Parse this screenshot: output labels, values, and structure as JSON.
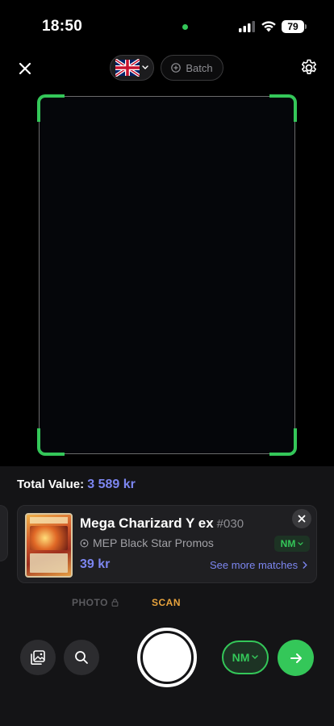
{
  "status_bar": {
    "time": "18:50",
    "battery": "79",
    "icons": [
      "signal-icon",
      "wifi-icon",
      "battery-icon"
    ]
  },
  "top_bar": {
    "close_icon": "close-icon",
    "language_flag": "uk-flag-icon",
    "batch_label": "Batch",
    "settings_icon": "gear-icon"
  },
  "summary": {
    "total_label": "Total Value:",
    "total_value": "3 589 kr"
  },
  "result_card": {
    "name": "Mega Charizard Y ex",
    "number": "#030",
    "set": "MEP Black Star Promos",
    "price": "39 kr",
    "condition": "NM",
    "see_more_label": "See more matches"
  },
  "mode_tabs": {
    "photo": "PHOTO",
    "scan": "SCAN",
    "active": "SCAN"
  },
  "controls": {
    "condition": "NM",
    "gallery_icon": "gallery-icon",
    "search_icon": "search-icon",
    "next_icon": "arrow-right-icon"
  },
  "colors": {
    "accent_green": "#34c759",
    "accent_blue": "#7c86f0",
    "accent_orange": "#e8a33d",
    "panel_bg": "#141416"
  }
}
